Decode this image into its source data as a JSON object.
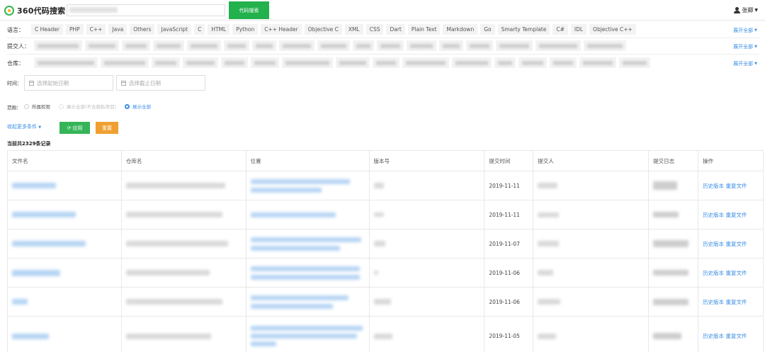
{
  "header": {
    "logo_text": "360代码搜索",
    "search_button": "代码搜索",
    "user_name": "张卿"
  },
  "filters": {
    "language_label": "语言：",
    "languages": [
      "C Header",
      "PHP",
      "C++",
      "Java",
      "Others",
      "JavaScript",
      "C",
      "HTML",
      "Python",
      "C++ Header",
      "Objective C",
      "XML",
      "CSS",
      "Dart",
      "Plain Text",
      "Markdown",
      "Go",
      "Smarty Template",
      "C#",
      "IDL",
      "Objective C++"
    ],
    "submitter_label": "提交人：",
    "repo_label": "仓库：",
    "expand_all": "展开全部",
    "time_label": "时间：",
    "start_date_placeholder": "选择起始日期",
    "end_date_placeholder": "选择截止日期",
    "scope_label": "范围：",
    "scope_options": [
      {
        "label": "所属权限",
        "state": "unchecked"
      },
      {
        "label": "展示全部(不含隐私项目)",
        "state": "disabled"
      },
      {
        "label": "展示全部",
        "state": "checked"
      }
    ],
    "collapse_more": "收起更多条件",
    "apply_button": "应用",
    "reset_button": "重置"
  },
  "result_count": "当前共2329条记录",
  "table": {
    "headers": [
      "文件名",
      "仓库名",
      "位置",
      "版本号",
      "提交时间",
      "提交人",
      "提交日志",
      "操作"
    ],
    "rows": [
      {
        "time": "2019-11-11",
        "ops": "历史版本 重复文件"
      },
      {
        "time": "2019-11-11",
        "ops": "历史版本 重复文件"
      },
      {
        "time": "2019-11-07",
        "ops": "历史版本 重复文件"
      },
      {
        "time": "2019-11-06",
        "ops": "历史版本 重复文件"
      },
      {
        "time": "2019-11-06",
        "ops": "历史版本 重复文件"
      },
      {
        "time": "2019-11-05",
        "ops": "历史版本 重复文件"
      }
    ]
  },
  "colors": {
    "accent_green": "#22b14c",
    "link_blue": "#3a8ee6",
    "reset_orange": "#f0a030"
  }
}
